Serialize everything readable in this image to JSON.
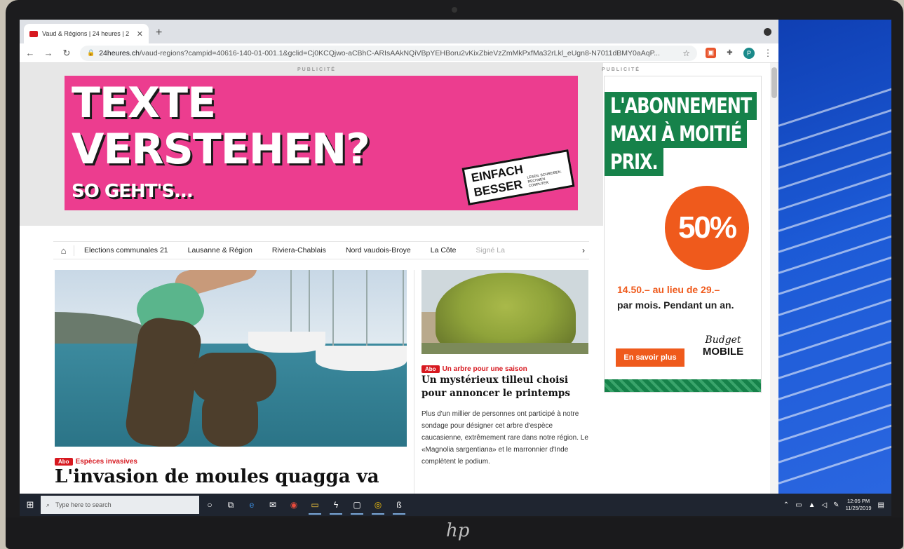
{
  "browser": {
    "tab_title": "Vaud & Régions | 24 heures | 2",
    "new_tab_symbol": "+",
    "url_host": "24heures.ch",
    "url_path": "/vaud-regions?campid=40616-140-01-001.1&gclid=Cj0KCQjwo-aCBhC-ARIsAAkNQiVBpYEHBoru2vKixZbieVzZmMkPxfMa32rLkl_eUgn8-N7011dBMY0aAqP...",
    "profile_initial": "P"
  },
  "ads": {
    "label": "PUBLICITÉ",
    "banner": {
      "line1": "TEXTE",
      "line2": "VERSTEHEN?",
      "line3": "SO GEHT'S...",
      "logo_word1": "EINFACH",
      "logo_word2": "BESSER",
      "logo_small": "LESEN. SCHREIBEN. RECHNEN. COMPUTER.",
      "colors": {
        "background": "#ec3d8f"
      }
    },
    "side": {
      "line1": "L'ABONNEMENT",
      "line2": "MAXI À MOITIÉ",
      "line3": "PRIX.",
      "percent": "50%",
      "price": "14.50.– au lieu de 29.–",
      "per_month": "par mois. Pendant un an.",
      "cta": "En savoir plus",
      "brand1": "Budget",
      "brand2": "MOBILE",
      "colors": {
        "green": "#16824a",
        "orange": "#ef5a1c"
      }
    }
  },
  "nav": {
    "items": [
      "Elections communales 21",
      "Lausanne & Région",
      "Riviera-Chablais",
      "Nord vaudois-Broye",
      "La Côte",
      "Signé La"
    ]
  },
  "articles": [
    {
      "badge": "Abo",
      "kicker": "Espèces invasives",
      "title": "L'invasion de moules quagga va"
    },
    {
      "badge": "Abo",
      "kicker": "Un arbre pour une saison",
      "title": "Un mystérieux tilleul choisi pour annoncer le printemps",
      "body": "Plus d'un millier de personnes ont participé à notre sondage pour désigner cet arbre d'espèce caucasienne, extrêmement rare dans notre région. Le «Magnolia sargentiana» et le marronnier d'Inde complètent le podium."
    }
  ],
  "taskbar": {
    "search_placeholder": "Type here to search",
    "time": "12:05 PM",
    "date": "11/25/2019"
  },
  "device": {
    "brand_logo": "hp"
  }
}
